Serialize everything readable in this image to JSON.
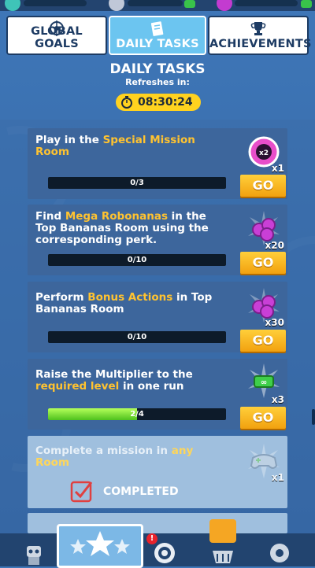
{
  "tabs": [
    {
      "label": "GLOBAL GOALS",
      "icon": "globe-target-icon",
      "active": false
    },
    {
      "label": "DAILY TASKS",
      "icon": "clipboard-icon",
      "active": true
    },
    {
      "label": "ACHIEVEMENTS",
      "icon": "trophy-icon",
      "active": false
    }
  ],
  "header": {
    "title": "DAILY TASKS",
    "subtitle": "Refreshes in:",
    "timer": "08:30:24"
  },
  "tasks": [
    {
      "text_parts": [
        "Play in the ",
        "Special Mission Room",
        ""
      ],
      "progress_text": "0/3",
      "progress": 0.0,
      "reward_icon": "special-mission-token-icon",
      "multiplier": "x1",
      "button": "GO"
    },
    {
      "text_parts": [
        "Find ",
        "Mega Robonanas",
        " in the Top Bananas Room using the corresponding perk."
      ],
      "progress_text": "0/10",
      "progress": 0.0,
      "reward_icon": "robonana-gems-icon",
      "multiplier": "x20",
      "button": "GO"
    },
    {
      "text_parts": [
        "Perform ",
        "Bonus Actions",
        " in Top Bananas Room"
      ],
      "progress_text": "0/10",
      "progress": 0.0,
      "reward_icon": "robonana-gems-icon",
      "multiplier": "x30",
      "button": "GO"
    },
    {
      "text_parts": [
        "Raise the Multiplier to the ",
        "required level",
        " in one run"
      ],
      "progress_text": "2/4",
      "progress": 0.5,
      "reward_icon": "multiplier-badge-icon",
      "multiplier": "x3",
      "button": "GO"
    }
  ],
  "completed_task": {
    "text_parts": [
      "Complete a mission in ",
      "any Room",
      ""
    ],
    "reward_icon": "gamepad-icon",
    "multiplier": "x1",
    "status": "COMPLETED"
  },
  "colors": {
    "highlight": "#ffc330",
    "go_button": "#f5b01e",
    "progress_fill": "#6fd42a",
    "active_tab": "#6cc5f0"
  },
  "bottom_nav": {
    "icons": [
      "robot-icon",
      "stars-icon",
      "minion-goggle-icon",
      "shop-basket-icon",
      "wrench-settings-icon"
    ],
    "notification_badge": "!"
  }
}
